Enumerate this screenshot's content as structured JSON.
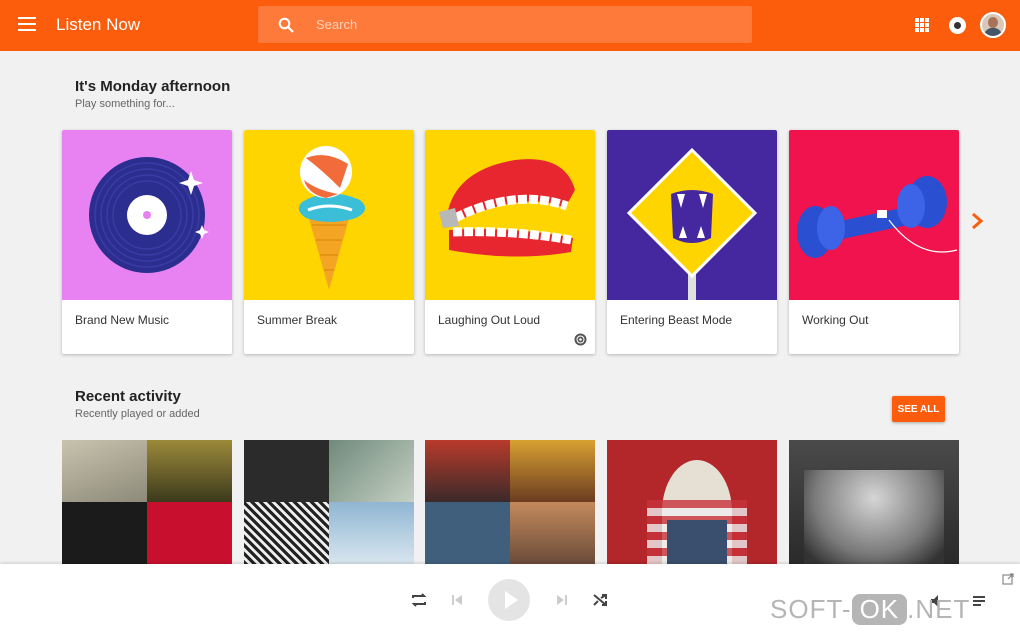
{
  "header": {
    "app_title": "Listen Now",
    "search_placeholder": "Search",
    "brand_color": "#fb5d0c"
  },
  "listen_now": {
    "title": "It's Monday afternoon",
    "subtitle": "Play something for...",
    "cards": [
      {
        "label": "Brand New Music",
        "bg": "#e882f2"
      },
      {
        "label": "Summer Break",
        "bg": "#ffd500"
      },
      {
        "label": "Laughing Out Loud",
        "bg": "#ffd500",
        "badge": "radio-icon"
      },
      {
        "label": "Entering Beast Mode",
        "bg": "#4527a0"
      },
      {
        "label": "Working Out",
        "bg": "#f0134d"
      }
    ]
  },
  "recent": {
    "title": "Recent activity",
    "subtitle": "Recently played or added",
    "see_all_label": "SEE ALL"
  },
  "watermark": {
    "left": "SOFT-",
    "ok": "OK",
    "right": ".NET"
  }
}
